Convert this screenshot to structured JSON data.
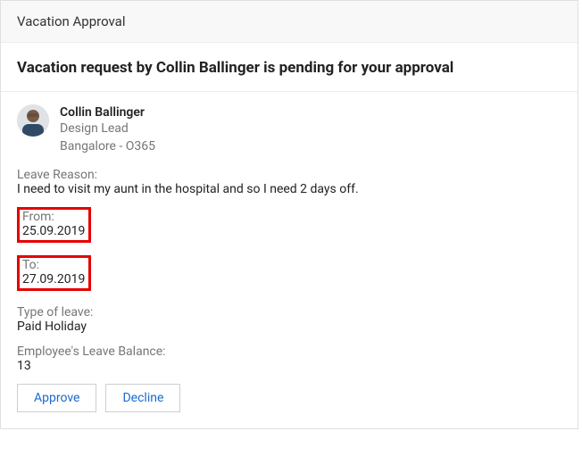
{
  "header": {
    "title": "Vacation Approval"
  },
  "title": "Vacation request by Collin Ballinger is pending for your approval",
  "person": {
    "name": "Collin Ballinger",
    "role": "Design Lead",
    "location": "Bangalore - O365"
  },
  "fields": {
    "reason_label": "Leave Reason:",
    "reason_value": "I need to visit my aunt in the hospital and so I need 2 days off.",
    "from_label": "From:",
    "from_value": "25.09.2019",
    "to_label": "To:",
    "to_value": "27.09.2019",
    "type_label": "Type of leave:",
    "type_value": "Paid Holiday",
    "balance_label": "Employee's Leave Balance:",
    "balance_value": "13"
  },
  "actions": {
    "approve": "Approve",
    "decline": "Decline"
  }
}
